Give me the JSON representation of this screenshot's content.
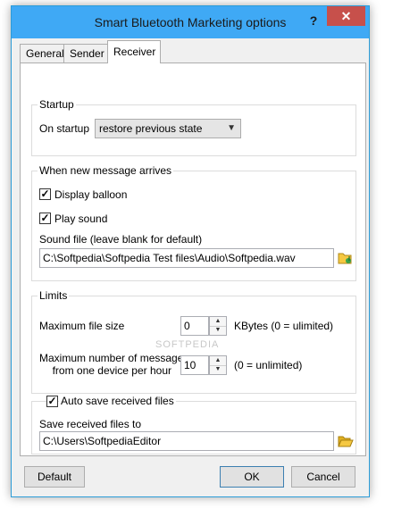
{
  "window": {
    "title": "Smart Bluetooth Marketing options",
    "help_label": "?",
    "close_label": "✕"
  },
  "tabs": [
    {
      "label": "General"
    },
    {
      "label": "Sender"
    },
    {
      "label": "Receiver"
    }
  ],
  "startup": {
    "legend": "Startup",
    "label": "On startup",
    "value": "restore previous state"
  },
  "new_message": {
    "legend": "When new message arrives",
    "display_balloon": {
      "label": "Display balloon",
      "checked": true
    },
    "play_sound": {
      "label": "Play sound",
      "checked": true
    },
    "sound_file_label": "Sound file (leave blank for default)",
    "sound_file_value": "C:\\Softpedia\\Softpedia Test files\\Audio\\Softpedia.wav"
  },
  "limits": {
    "legend": "Limits",
    "max_file_size_label": "Maximum file size",
    "max_file_size_value": "0",
    "max_file_size_unit": "KBytes   (0 = ulimited)",
    "max_messages_label_1": "Maximum number of messages",
    "max_messages_label_2": "from one device per hour",
    "max_messages_value": "10",
    "max_messages_note": "(0 = unlimited)"
  },
  "autosave": {
    "label": "Auto save received files",
    "checked": true,
    "path_label": "Save received files to",
    "path_value": "C:\\Users\\SoftpediaEditor"
  },
  "buttons": {
    "default": "Default",
    "ok": "OK",
    "cancel": "Cancel"
  },
  "watermark": "SOFTPEDIA",
  "colors": {
    "titlebar": "#3fa9f5",
    "close": "#c7504b",
    "folder": "#f5c842"
  }
}
